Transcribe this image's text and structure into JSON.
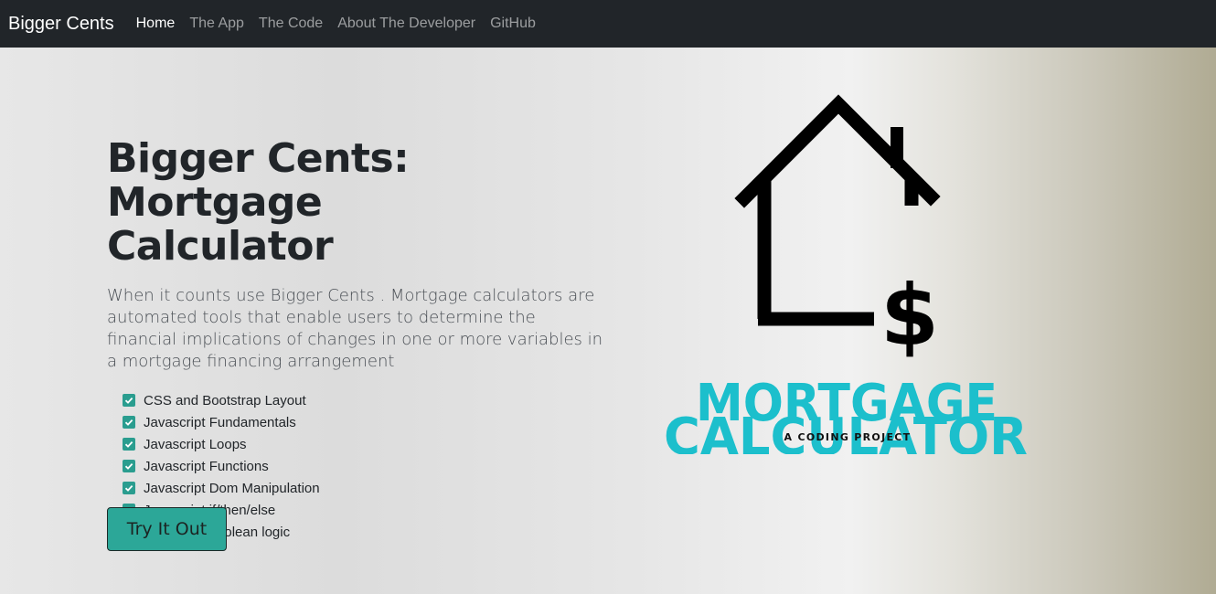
{
  "nav": {
    "brand": "Bigger Cents",
    "links": [
      "Home",
      "The App",
      "The Code",
      "About The Developer",
      "GitHub"
    ]
  },
  "hero": {
    "title_line1": "Bigger Cents: Mortgage",
    "title_line2": "Calculator",
    "lead": "When it counts use Bigger Cents . Mortgage calculators are automated tools that enable users to determine the financial implications of changes in one or more variables in a mortgage financing arrangement",
    "checklist": [
      "CSS and Bootstrap Layout",
      "Javascript Fundamentals",
      "Javascript Loops",
      "Javascript Functions",
      "Javascript Dom Manipulation",
      "Javascript if/then/else",
      "Javascript boolean logic"
    ],
    "button_label": "Try It Out"
  },
  "logo": {
    "line1": "MORTGAGE",
    "line2": "CALCULATOR",
    "tagline": "A CODING PROJECT",
    "dollar": "$"
  },
  "colors": {
    "navbar": "#212529",
    "accent": "#2ca798",
    "logo_text": "#1cbfcc"
  }
}
